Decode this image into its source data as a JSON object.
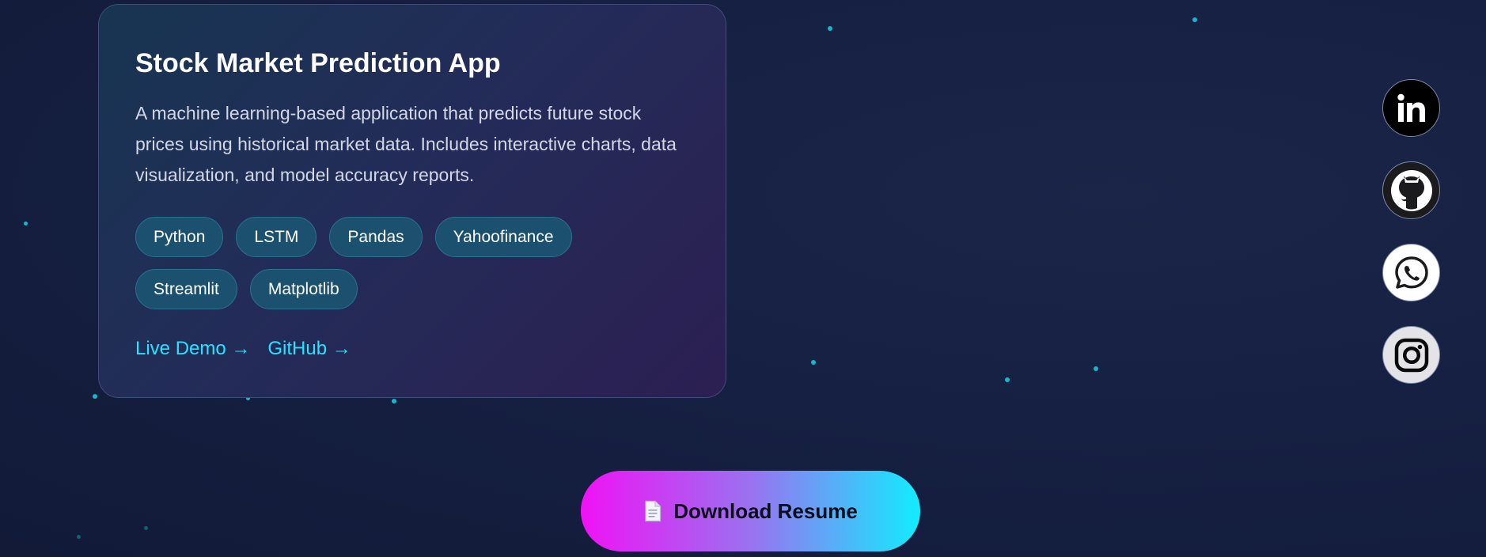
{
  "project": {
    "title": "Stock Market Prediction App",
    "description": "A machine learning-based application that predicts future stock prices using historical market data. Includes interactive charts, data visualization, and model accuracy reports.",
    "tags": [
      "Python",
      "LSTM",
      "Pandas",
      "Yahoofinance",
      "Streamlit",
      "Matplotlib"
    ],
    "links": {
      "live_demo": "Live Demo →",
      "github": "GitHub →"
    }
  },
  "socials": [
    {
      "name": "linkedin",
      "icon": "linkedin-icon"
    },
    {
      "name": "github",
      "icon": "github-icon"
    },
    {
      "name": "whatsapp",
      "icon": "whatsapp-icon"
    },
    {
      "name": "instagram",
      "icon": "instagram-icon"
    }
  ],
  "download": {
    "label": "Download Resume",
    "icon": "document-icon"
  },
  "colors": {
    "accent_cyan": "#22e5ff",
    "accent_magenta": "#f012f5",
    "background": "#162042",
    "tag_bg": "#1b506e"
  }
}
